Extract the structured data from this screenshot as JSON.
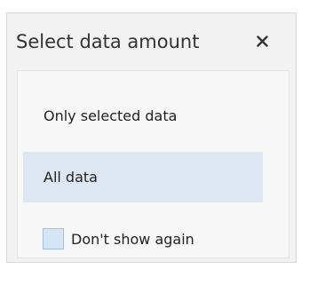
{
  "dialog": {
    "title": "Select data amount",
    "close_icon": "close-icon"
  },
  "options": [
    {
      "label": "Only selected data",
      "selected": false
    },
    {
      "label": "All data",
      "selected": true
    }
  ],
  "dont_show_again": {
    "label": "Don't show again",
    "checked": false
  },
  "colors": {
    "dialog_background": "#f2f2f2",
    "selected_option_background": "#dde7f2",
    "checkbox_fill": "#d6e5f6"
  }
}
